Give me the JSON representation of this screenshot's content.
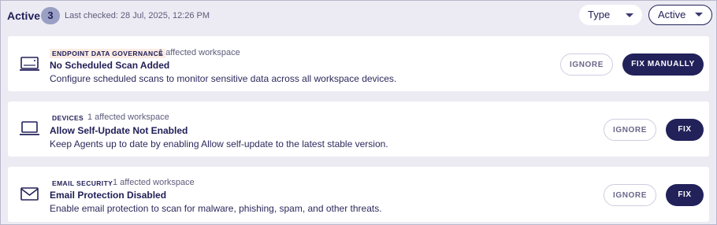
{
  "header": {
    "title": "Active",
    "count": "3",
    "last_checked": "Last checked: 28 Jul, 2025, 12:26 PM",
    "filters": [
      {
        "label": "Type"
      },
      {
        "label": "Active"
      }
    ]
  },
  "cards": [
    {
      "category": "ENDPOINT DATA GOVERNANCE",
      "affected": "1 affected workspace",
      "title": "No Scheduled Scan Added",
      "description": "Configure scheduled scans to monitor sensitive data across all workspace devices.",
      "ignore_label": "IGNORE",
      "fix_label": "FIX MANUALLY",
      "icon": "hard-drive-icon"
    },
    {
      "category": "DEVICES",
      "affected": "1 affected workspace",
      "title": "Allow Self-Update Not Enabled",
      "description": "Keep Agents up to date by enabling Allow self-update to the latest stable version.",
      "ignore_label": "IGNORE",
      "fix_label": "FIX",
      "icon": "laptop-icon"
    },
    {
      "category": "EMAIL SECURITY",
      "affected": "1 affected workspace",
      "title": "Email Protection Disabled",
      "description": "Enable email protection to scan for malware, phishing, spam, and other threats.",
      "ignore_label": "IGNORE",
      "fix_label": "FIX",
      "icon": "envelope-icon"
    }
  ],
  "colors": {
    "accent": "#22215a",
    "background": "#ecebf3",
    "badge": "#9a9fc4",
    "tag_highlight": "#fbece4"
  }
}
